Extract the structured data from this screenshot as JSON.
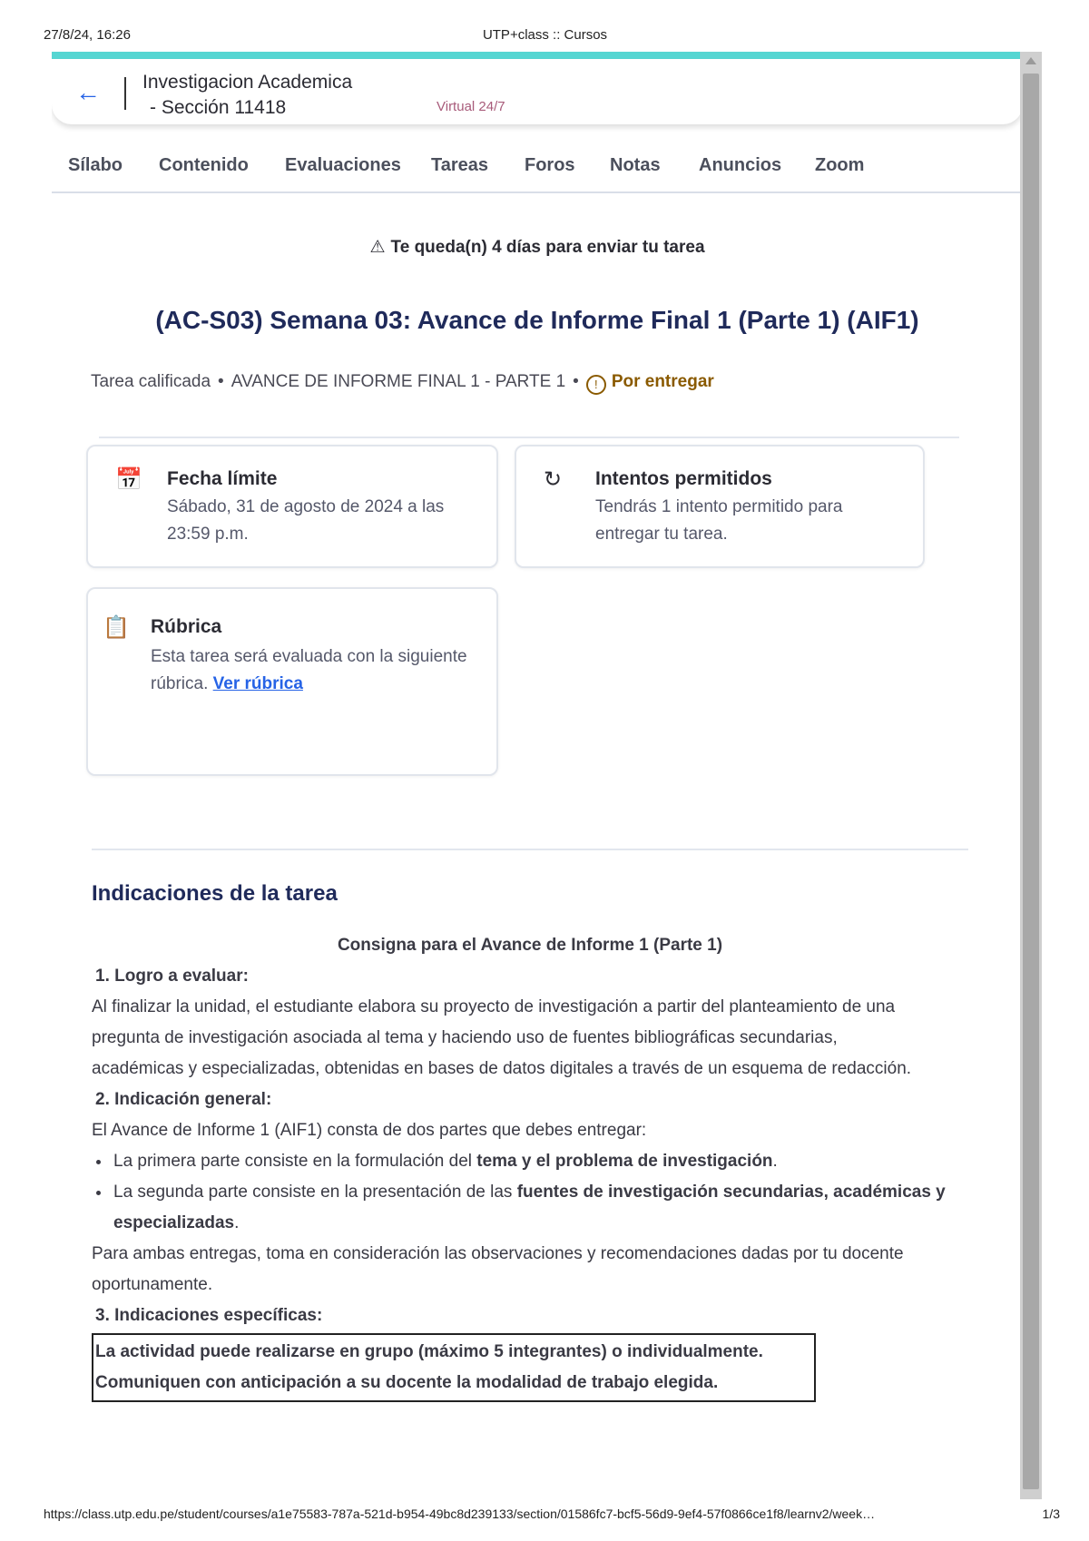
{
  "print": {
    "date": "27/8/24, 16:26",
    "title": "UTP+class :: Cursos",
    "url": "https://class.utp.edu.pe/student/courses/a1e75583-787a-521d-b954-49bc8d239133/section/01586fc7-bcf5-56d9-9ef4-57f0866ce1f8/learnv2/week…",
    "page": "1/3"
  },
  "course": {
    "title_line1": "Investigacion Academica",
    "title_line2": "- Sección 11418",
    "modality": "Virtual 24/7"
  },
  "nav": {
    "tabs": [
      "Sílabo",
      "Contenido",
      "Evaluaciones",
      "Tareas",
      "Foros",
      "Notas",
      "Anuncios",
      "Zoom"
    ]
  },
  "alert": {
    "text": "Te queda(n) 4 días para enviar tu tarea"
  },
  "task": {
    "title": "(AC-S03) Semana 03: Avance de Informe Final 1 (Parte 1) (AIF1)",
    "type": "Tarea calificada",
    "name": "AVANCE DE INFORME FINAL 1 - PARTE 1",
    "status": "Por entregar"
  },
  "cards": {
    "deadline": {
      "title": "Fecha límite",
      "line1": "Sábado, 31 de agosto de 2024 a las",
      "line2": "23:59 p.m."
    },
    "attempts": {
      "title": "Intentos permitidos",
      "line1": "Tendrás 1 intento permitido para",
      "line2": "entregar tu tarea."
    },
    "rubric": {
      "title": "Rúbrica",
      "line1": "Esta tarea será evaluada con la siguiente",
      "line2": "rúbrica.",
      "link": "Ver rúbrica"
    }
  },
  "instructions": {
    "section_title": "Indicaciones de la tarea",
    "heading": "Consigna para el Avance de Informe 1 (Parte 1)",
    "h1": "1. Logro a evaluar:",
    "p1a": "Al finalizar la unidad, el estudiante elabora su proyecto de investigación a partir del planteamiento de una",
    "p1b": "pregunta de investigación asociada al tema y haciendo uso de fuentes bibliográficas secundarias,",
    "p1c": "académicas y especializadas, obtenidas en bases de datos digitales a través de un esquema de redacción.",
    "h2": "2. Indicación general:",
    "p2": "El Avance de Informe 1 (AIF1) consta de dos partes que debes entregar:",
    "b1_pre": "La primera parte consiste en la formulación del ",
    "b1_bold": "tema y el problema de investigación",
    "b1_post": ".",
    "b2_pre": "La segunda parte consiste en la presentación de las ",
    "b2_bold": "fuentes de investigación secundarias, académicas y especializadas",
    "b2_post": ".",
    "p3a": "Para ambas entregas, toma en consideración las observaciones y recomendaciones dadas por tu docente",
    "p3b": "oportunamente.",
    "h3": "3. Indicaciones específicas:",
    "box1": "La actividad puede realizarse en grupo (máximo 5 integrantes) o individualmente.",
    "box2": "Comuniquen con anticipación a su docente la modalidad de trabajo elegida."
  }
}
